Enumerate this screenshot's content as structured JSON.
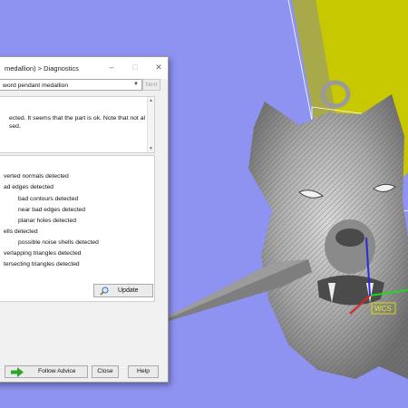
{
  "window": {
    "title": "medallion) > Diagnostics",
    "minimize_glyph": "–",
    "maximize_glyph": "□",
    "close_glyph": "✕"
  },
  "part_selector": {
    "value": "word pendant  medallion",
    "next_label": "Next"
  },
  "message": {
    "text": "ected. It seems that the part is ok. Note that not all\nsed."
  },
  "diagnostics": {
    "items": [
      {
        "label": "verted normals detected"
      },
      {
        "label": "ad edges detected"
      },
      {
        "label": "bad contours detected"
      },
      {
        "label": "near bad edges detected"
      },
      {
        "label": "planar holes detected"
      },
      {
        "label": "ells detected"
      },
      {
        "label": "possible noise shells detected"
      },
      {
        "label": "verlapping triangles detected"
      },
      {
        "label": "tersecting triangles detected"
      }
    ],
    "update_label": "Update",
    "update_icon": "magnifier-icon"
  },
  "footer": {
    "follow_advice_label": "Follow Advice",
    "follow_advice_icon": "green-arrow-icon",
    "close_label": "Close",
    "help_label": "Help"
  },
  "viewport": {
    "wcs_label": "WCS",
    "background_color": "#8e92f0",
    "build_volume_color": "#c8c800"
  }
}
